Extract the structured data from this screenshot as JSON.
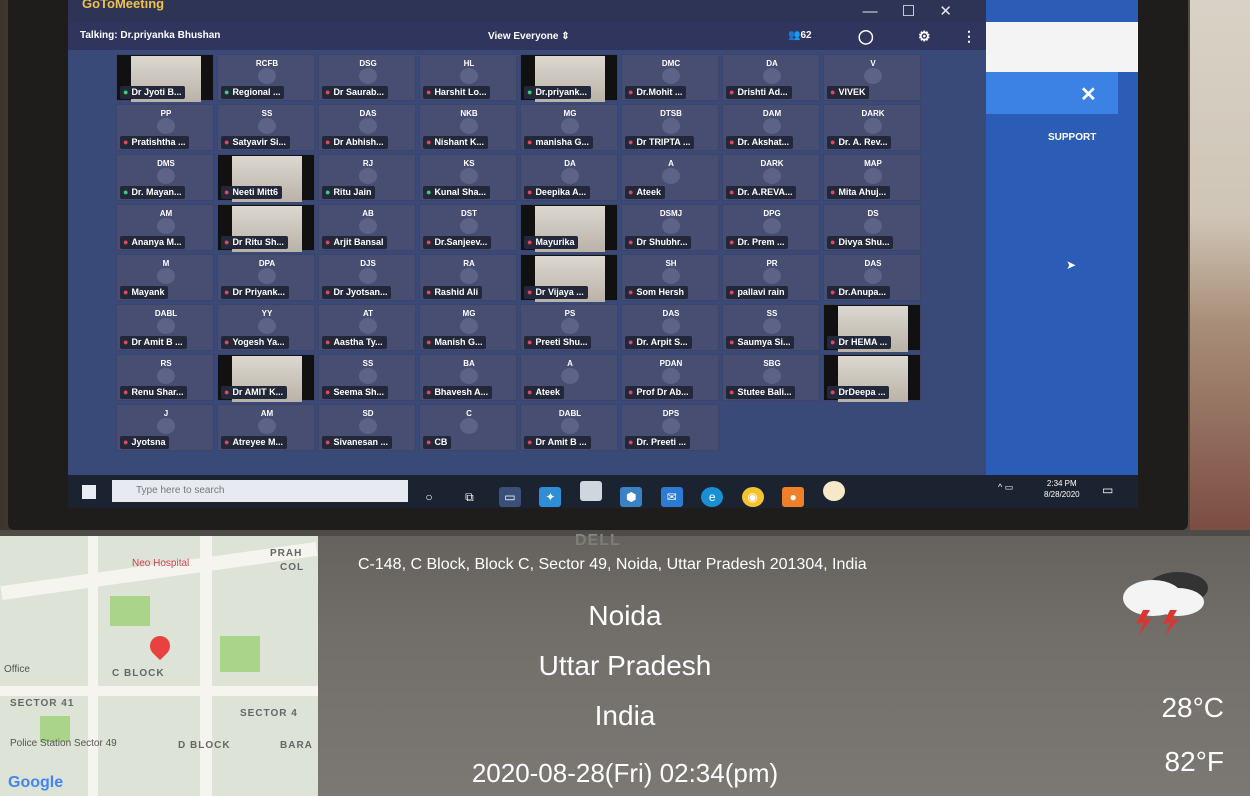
{
  "app": {
    "logo": "GoToMeeting",
    "talking": "Talking: Dr.priyanka Bhushan",
    "view": "View Everyone",
    "participants_count": "62"
  },
  "tiles": [
    {
      "name": "Dr Jyoti B...",
      "ini": "",
      "mic": "on",
      "video": true
    },
    {
      "name": "Regional ...",
      "ini": "RCFB",
      "mic": "on"
    },
    {
      "name": "Dr Saurab...",
      "ini": "DSG",
      "mic": "off"
    },
    {
      "name": "Harshit Lo...",
      "ini": "HL",
      "mic": "off"
    },
    {
      "name": "Dr.priyank...",
      "ini": "",
      "mic": "on",
      "video": true
    },
    {
      "name": "Dr.Mohit ...",
      "ini": "DMC",
      "mic": "off"
    },
    {
      "name": "Drishti Ad...",
      "ini": "DA",
      "mic": "off"
    },
    {
      "name": "VIVEK",
      "ini": "V",
      "mic": "off"
    },
    {
      "name": "Pratishtha ...",
      "ini": "PP",
      "mic": "off"
    },
    {
      "name": "Satyavir Si...",
      "ini": "SS",
      "mic": "off"
    },
    {
      "name": "Dr Abhish...",
      "ini": "DAS",
      "mic": "off"
    },
    {
      "name": "Nishant K...",
      "ini": "NKB",
      "mic": "off"
    },
    {
      "name": "manisha G...",
      "ini": "MG",
      "mic": "off"
    },
    {
      "name": "Dr TRIPTA ...",
      "ini": "DTSB",
      "mic": "off"
    },
    {
      "name": "Dr. Akshat...",
      "ini": "DAM",
      "mic": "off"
    },
    {
      "name": "Dr. A. Rev...",
      "ini": "DARK",
      "mic": "off"
    },
    {
      "name": "Dr. Mayan...",
      "ini": "DMS",
      "mic": "on"
    },
    {
      "name": "Neeti Mitt6",
      "ini": "",
      "mic": "off",
      "video": true
    },
    {
      "name": "Ritu Jain",
      "ini": "RJ",
      "mic": "on"
    },
    {
      "name": "Kunal Sha...",
      "ini": "KS",
      "mic": "on"
    },
    {
      "name": "Deepika A...",
      "ini": "DA",
      "mic": "off"
    },
    {
      "name": "Ateek",
      "ini": "A",
      "mic": "off"
    },
    {
      "name": "Dr. A.REVA...",
      "ini": "DARK",
      "mic": "off"
    },
    {
      "name": "Mita Ahuj...",
      "ini": "MAP",
      "mic": "off"
    },
    {
      "name": "Ananya M...",
      "ini": "AM",
      "mic": "off"
    },
    {
      "name": "Dr Ritu Sh...",
      "ini": "",
      "mic": "off",
      "video": true
    },
    {
      "name": "Arjit Bansal",
      "ini": "AB",
      "mic": "off"
    },
    {
      "name": "Dr.Sanjeev...",
      "ini": "DST",
      "mic": "off"
    },
    {
      "name": "Mayurika",
      "ini": "",
      "mic": "off",
      "video": true
    },
    {
      "name": "Dr Shubhr...",
      "ini": "DSMJ",
      "mic": "off"
    },
    {
      "name": "Dr. Prem ...",
      "ini": "DPG",
      "mic": "off"
    },
    {
      "name": "Divya Shu...",
      "ini": "DS",
      "mic": "off"
    },
    {
      "name": "Mayank",
      "ini": "M",
      "mic": "off"
    },
    {
      "name": "Dr Priyank...",
      "ini": "DPA",
      "mic": "off"
    },
    {
      "name": "Dr Jyotsan...",
      "ini": "DJS",
      "mic": "off"
    },
    {
      "name": "Rashid Ali",
      "ini": "RA",
      "mic": "off"
    },
    {
      "name": "Dr Vijaya ...",
      "ini": "",
      "mic": "off",
      "video": true
    },
    {
      "name": "Som Hersh",
      "ini": "SH",
      "mic": "off"
    },
    {
      "name": "pallavi rain",
      "ini": "PR",
      "mic": "off"
    },
    {
      "name": "Dr.Anupa...",
      "ini": "DAS",
      "mic": "off"
    },
    {
      "name": "Dr Amit B ...",
      "ini": "DABL",
      "mic": "off"
    },
    {
      "name": "Yogesh Ya...",
      "ini": "YY",
      "mic": "off"
    },
    {
      "name": "Aastha Ty...",
      "ini": "AT",
      "mic": "off"
    },
    {
      "name": "Manish G...",
      "ini": "MG",
      "mic": "off"
    },
    {
      "name": "Preeti Shu...",
      "ini": "PS",
      "mic": "off"
    },
    {
      "name": "Dr. Arpit S...",
      "ini": "DAS",
      "mic": "off"
    },
    {
      "name": "Saumya Si...",
      "ini": "SS",
      "mic": "off"
    },
    {
      "name": "Dr HEMA ...",
      "ini": "",
      "mic": "off",
      "video": true
    },
    {
      "name": "Renu Shar...",
      "ini": "RS",
      "mic": "off"
    },
    {
      "name": "Dr AMIT K...",
      "ini": "",
      "mic": "off",
      "video": true
    },
    {
      "name": "Seema Sh...",
      "ini": "SS",
      "mic": "off"
    },
    {
      "name": "Bhavesh A...",
      "ini": "BA",
      "mic": "off"
    },
    {
      "name": "Ateek",
      "ini": "A",
      "mic": "off"
    },
    {
      "name": "Prof Dr Ab...",
      "ini": "PDAN",
      "mic": "off"
    },
    {
      "name": "Stutee Bali...",
      "ini": "SBG",
      "mic": "off"
    },
    {
      "name": "DrDeepa ...",
      "ini": "",
      "mic": "off",
      "video": true
    },
    {
      "name": "Jyotsna",
      "ini": "J",
      "mic": "off"
    },
    {
      "name": "Atreyee M...",
      "ini": "AM",
      "mic": "off"
    },
    {
      "name": "Sivanesan ...",
      "ini": "SD",
      "mic": "off"
    },
    {
      "name": "CB",
      "ini": "C",
      "mic": "off"
    },
    {
      "name": "Dr Amit B ...",
      "ini": "DABL",
      "mic": "off"
    },
    {
      "name": "Dr. Preeti ...",
      "ini": "DPS",
      "mic": "off"
    }
  ],
  "support_panel": {
    "label": "SUPPORT",
    "close": "✕"
  },
  "taskbar": {
    "search_placeholder": "Type here to search",
    "time": "2:34 PM",
    "date": "8/28/2020"
  },
  "dell_logo": "DELL",
  "map": {
    "labels": [
      "SECTOR 41",
      "SECTOR 4",
      "C BLOCK",
      "D BLOCK",
      "PRAH",
      "COL",
      "BARA"
    ],
    "pois": [
      "Neo Hospital",
      "Police Station Sector 49",
      "Office"
    ],
    "google": "Google"
  },
  "location": {
    "address": "C-148, C Block, Block C, Sector 49, Noida, Uttar Pradesh 201304, India",
    "city": "Noida",
    "state": "Uttar Pradesh",
    "country": "India",
    "datetime": "2020-08-28(Fri)   02:34(pm)",
    "temp_c": "28°C",
    "temp_f": "82°F"
  },
  "colors": {
    "mic_off": "#e2485a",
    "mic_on": "#3ccf7a",
    "panel_blue": "#2b5db6"
  }
}
